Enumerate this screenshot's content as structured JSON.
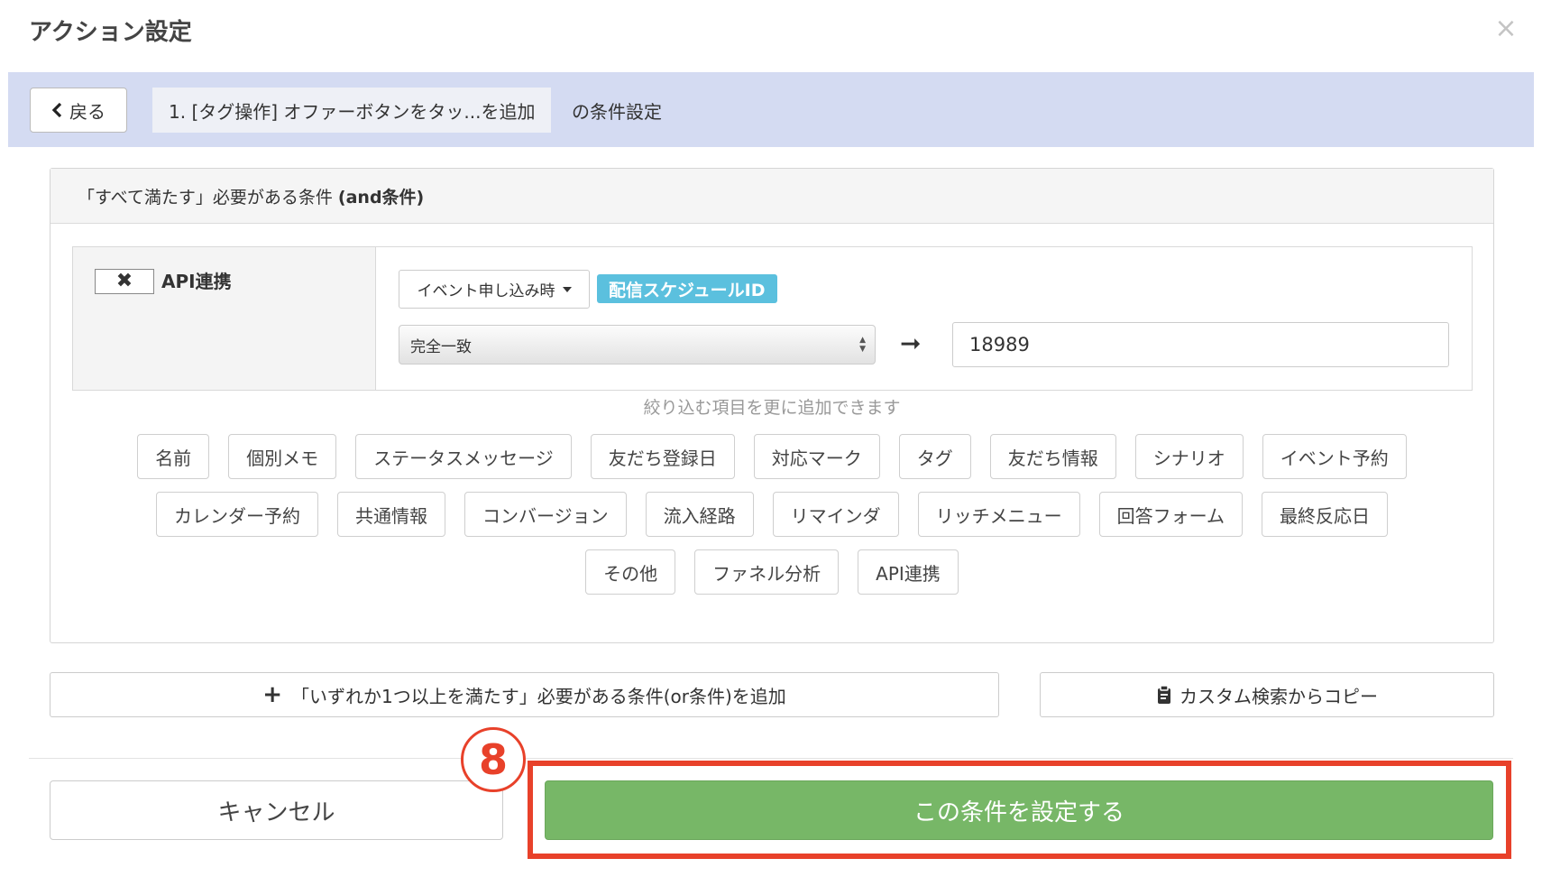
{
  "modal": {
    "title": "アクション設定",
    "close_label": "×"
  },
  "breadcrumb": {
    "back_label": "戻る",
    "action_name": "1. [タグ操作] オファーボタンをタッ...を追加",
    "suffix": "の条件設定"
  },
  "and_group": {
    "header_text": "「すべて満たす」必要がある条件",
    "header_bold": "(and条件)",
    "condition": {
      "remove_label": "✖",
      "type_label": "API連携",
      "event_dropdown": "イベント申し込み時",
      "field_badge": "配信スケジュールID",
      "match_select": "完全一致",
      "arrow": "➞",
      "value": "18989"
    },
    "hint": "絞り込む項目を更に追加できます",
    "chip_rows": [
      [
        "名前",
        "個別メモ",
        "ステータスメッセージ",
        "友だち登録日",
        "対応マーク",
        "タグ",
        "友だち情報",
        "シナリオ",
        "イベント予約"
      ],
      [
        "カレンダー予約",
        "共通情報",
        "コンバージョン",
        "流入経路",
        "リマインダ",
        "リッチメニュー",
        "回答フォーム",
        "最終反応日"
      ],
      [
        "その他",
        "ファネル分析",
        "API連携"
      ]
    ]
  },
  "actions": {
    "add_or_plus": "+",
    "add_or_label": "「いずれか1つ以上を満たす」必要がある条件(or条件)を追加",
    "copy_label": "カスタム検索からコピー",
    "cancel_label": "キャンセル",
    "confirm_label": "この条件を設定する"
  },
  "annotation": {
    "step_number": "8",
    "color": "#e8412a"
  },
  "colors": {
    "crumb_bar": "#d4dbf2",
    "badge": "#5bc0de",
    "confirm": "#77b767"
  }
}
